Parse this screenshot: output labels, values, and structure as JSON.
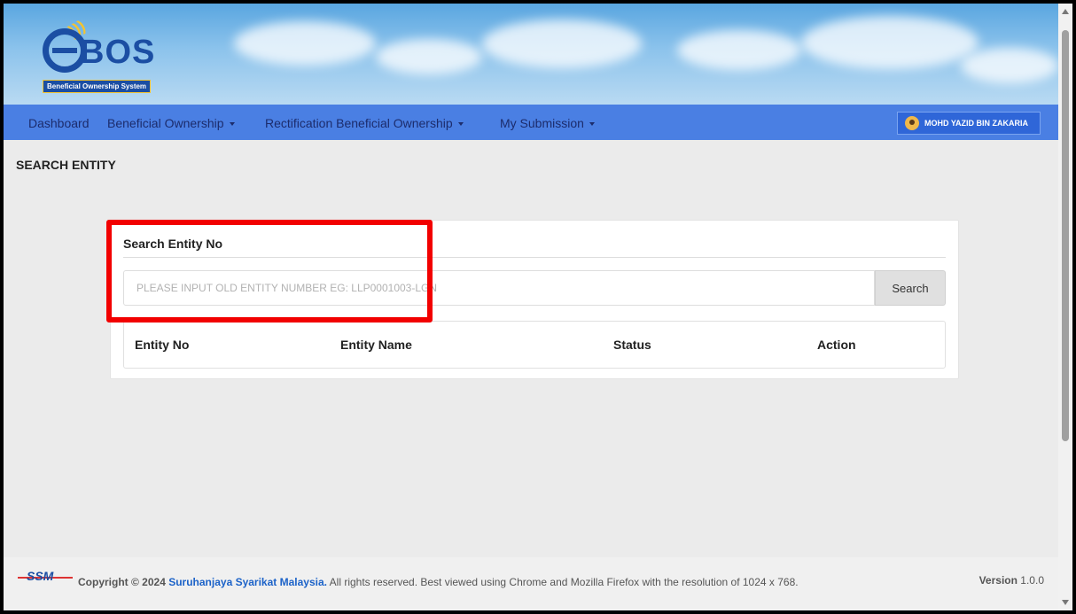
{
  "brand": {
    "logo_text": "BOS",
    "logo_subtitle": "Beneficial Ownership System"
  },
  "nav": {
    "items": [
      {
        "label": "Dashboard",
        "dropdown": false
      },
      {
        "label": "Beneficial Ownership",
        "dropdown": true
      },
      {
        "label": "Rectification Beneficial Ownership",
        "dropdown": true
      },
      {
        "label": "My Submission",
        "dropdown": true
      }
    ],
    "user_name": "MOHD YAZID BIN ZAKARIA"
  },
  "page": {
    "title": "SEARCH ENTITY"
  },
  "search": {
    "label": "Search Entity No",
    "placeholder": "PLEASE INPUT OLD ENTITY NUMBER EG: LLP0001003-LGN",
    "button": "Search"
  },
  "table": {
    "columns": [
      "Entity No",
      "Entity Name",
      "Status",
      "Action"
    ]
  },
  "footer": {
    "logo_text": "SSM",
    "prefix": "Copyright © 2024",
    "company": "Suruhanjaya Syarikat Malaysia.",
    "suffix": "All rights reserved. Best viewed using Chrome and Mozilla Firefox with the resolution of 1024 x 768.",
    "version_label": "Version",
    "version_value": "1.0.0"
  },
  "colors": {
    "navbar": "#4a7fe3",
    "highlight": "#f20000",
    "brand": "#1b4ea3"
  }
}
